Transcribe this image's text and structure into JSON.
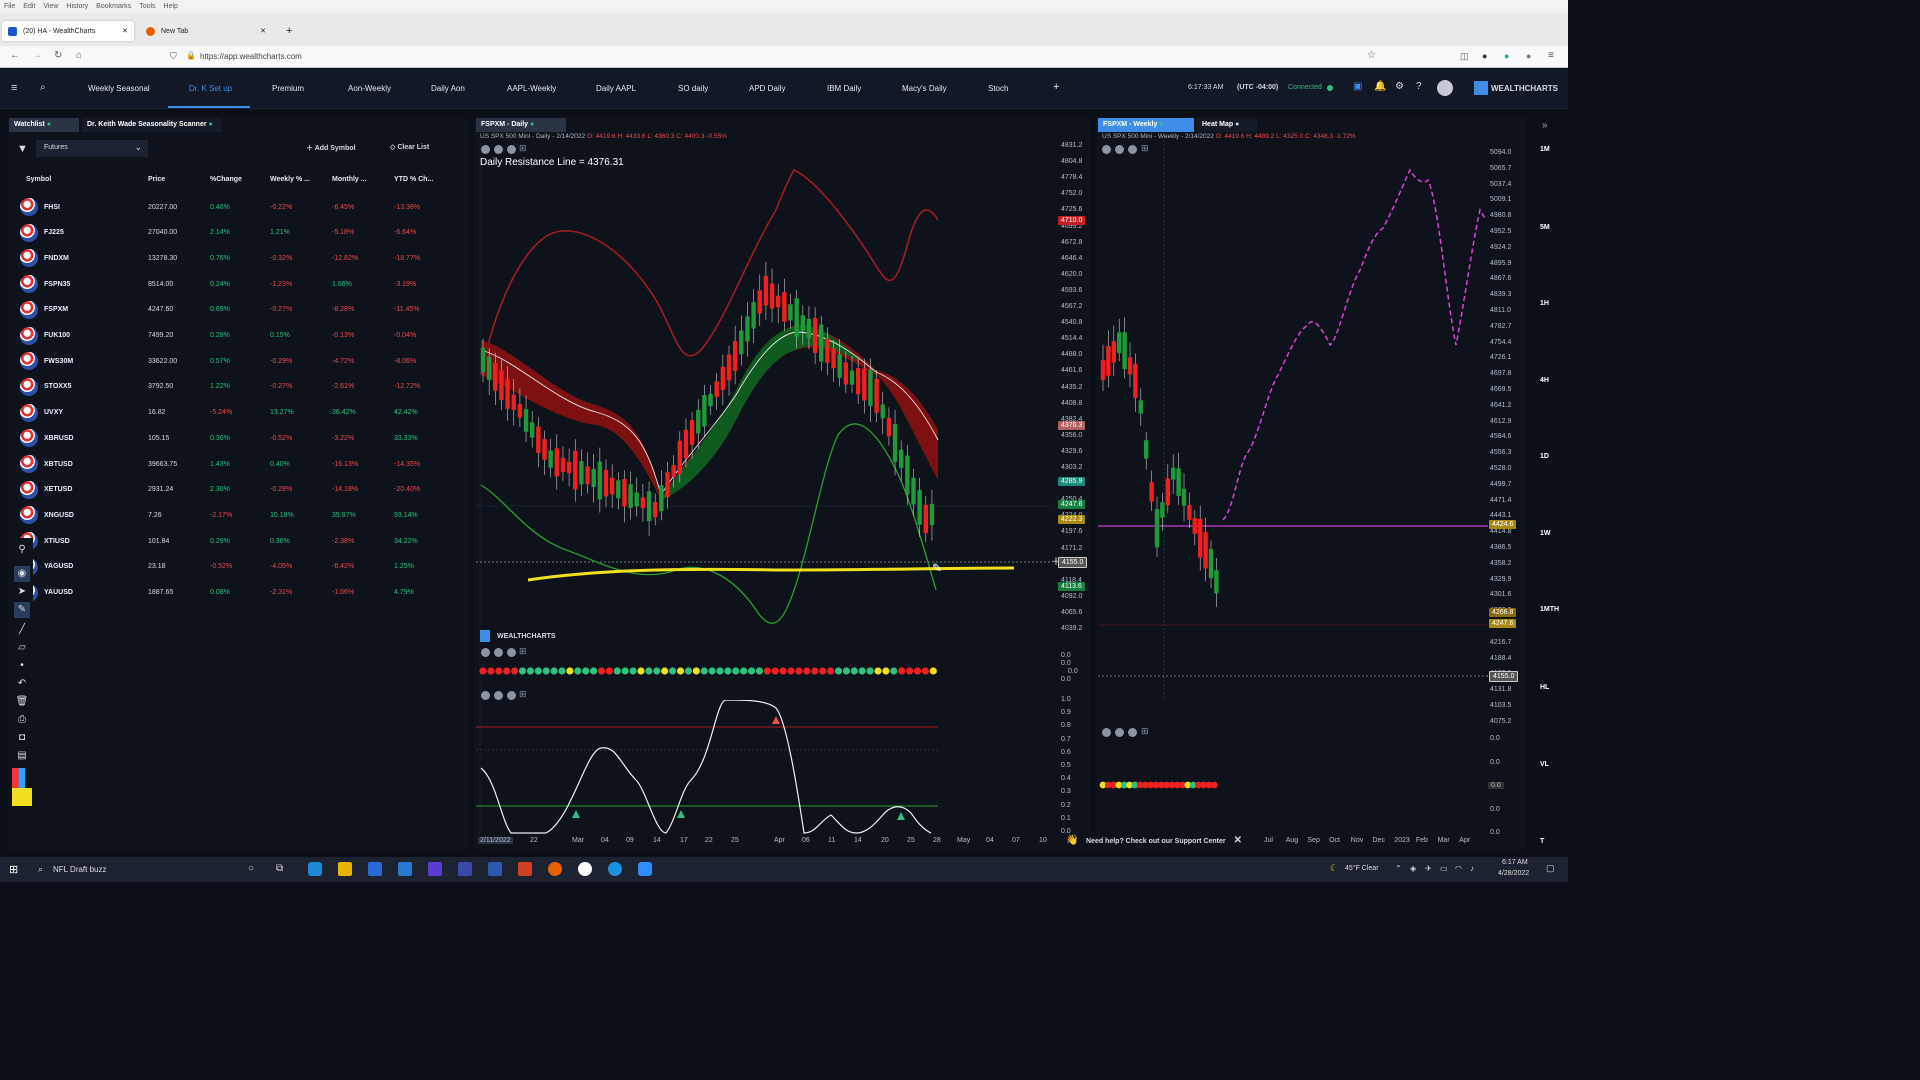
{
  "browser": {
    "menu": [
      "File",
      "Edit",
      "View",
      "History",
      "Bookmarks",
      "Tools",
      "Help"
    ],
    "tabs": [
      {
        "label": "(20) HA - WealthCharts"
      },
      {
        "label": "New Tab"
      }
    ],
    "url": "https://app.wealthcharts.com"
  },
  "nav": {
    "tabs": [
      "Weekly Seasonal",
      "Dr. K Set up",
      "Premium",
      "Aon-Weekly",
      "Daily Aon",
      "AAPL-Weekly",
      "Daily AAPL",
      "SO daily",
      "APD Daily",
      "IBM Daily",
      "Macy's Daily",
      "Stoch"
    ],
    "add": "+",
    "time": "6:17:33 AM",
    "tz": "(UTC -04:00)",
    "status": "Connected",
    "brand": "WEALTHCHARTS"
  },
  "watchlist": {
    "tab1": "Watchlist",
    "tab2": "Dr. Keith Wade Seasonality Scanner",
    "filter": "Futures",
    "add_symbol": "Add Symbol",
    "clear_list": "Clear List",
    "columns": [
      "Symbol",
      "Price",
      "%Change",
      "Weekly % ...",
      "Monthly ...",
      "YTD % Ch..."
    ],
    "rows": [
      [
        "FHSI",
        "20227.00",
        "0.46%",
        "-0.22%",
        "-6.45%",
        "-13.38%"
      ],
      [
        "FJ225",
        "27040.00",
        "2.14%",
        "1.21%",
        "-5.18%",
        "-6.64%"
      ],
      [
        "FNDXM",
        "13278.30",
        "0.76%",
        "-0.32%",
        "-12.82%",
        "-18.77%"
      ],
      [
        "FSPN35",
        "8514.00",
        "0.24%",
        "-1.23%",
        "1.66%",
        "-3.19%"
      ],
      [
        "FSPXM",
        "4247.60",
        "0.69%",
        "-0.27%",
        "-8.28%",
        "-11.45%"
      ],
      [
        "FUK100",
        "7499.20",
        "0.28%",
        "0.15%",
        "-0.13%",
        "-0.04%"
      ],
      [
        "FWS30M",
        "33622.00",
        "0.57%",
        "-0.29%",
        "-4.72%",
        "-8.06%"
      ],
      [
        "STOXX5",
        "3792.50",
        "1.22%",
        "-0.27%",
        "-2.61%",
        "-12.72%"
      ],
      [
        "UVXY",
        "16.82",
        "-5.24%",
        "13.27%",
        "36.42%",
        "42.42%"
      ],
      [
        "XBRUSD",
        "105.15",
        "0.36%",
        "-0.52%",
        "-3.22%",
        "33.33%"
      ],
      [
        "XBTUSD",
        "39663.75",
        "1.43%",
        "0.40%",
        "-16.13%",
        "-14.35%"
      ],
      [
        "XETUSD",
        "2931.24",
        "2.30%",
        "-0.28%",
        "-14.18%",
        "-20.40%"
      ],
      [
        "XNGUSD",
        "7.26",
        "-2.17%",
        "10.18%",
        "35.87%",
        "93.14%"
      ],
      [
        "XTIUSD",
        "101.84",
        "0.29%",
        "0.36%",
        "-2.38%",
        "34.22%"
      ],
      [
        "YAGUSD",
        "23.18",
        "-0.52%",
        "-4.05%",
        "-6.42%",
        "1.25%"
      ],
      [
        "YAUUSD",
        "1887.65",
        "0.08%",
        "-2.31%",
        "-1.66%",
        "4.79%"
      ]
    ]
  },
  "chart_main": {
    "tab": "FSPXM - Daily",
    "info_prefix": "US SPX 500 Mini - Daily - 2/14/2022",
    "o": "O: 4419.6",
    "h": "H: 4433.6",
    "l": "L: 4360.3",
    "c": "C: 4400.3",
    "chg": "-0.55%",
    "annotation": "Daily Resistance Line = 4376.31",
    "yticks": [
      "4831.2",
      "4804.8",
      "4778.4",
      "4752.0",
      "4725.6",
      "4699.2",
      "4672.8",
      "4646.4",
      "4620.0",
      "4593.6",
      "4567.2",
      "4540.8",
      "4514.4",
      "4488.0",
      "4461.6",
      "4435.2",
      "4408.8",
      "4382.4",
      "4356.0",
      "4329.6",
      "4303.2",
      "4276.8",
      "4250.4",
      "4224.0",
      "4197.6",
      "4171.2",
      "4144.8",
      "4118.4",
      "4092.0",
      "4065.6",
      "4039.2"
    ],
    "tags": [
      "4710.0",
      "4376.3",
      "4285.9",
      "4247.6",
      "4222.3",
      "4155.0",
      "4113.6"
    ],
    "xticks": [
      "2/11/2022",
      "22",
      "Mar",
      "04",
      "09",
      "14",
      "17",
      "22",
      "25",
      "Apr",
      "06",
      "11",
      "14",
      "20",
      "25",
      "28",
      "May",
      "04",
      "07",
      "10"
    ],
    "brand": "WEALTHCHARTS",
    "osc_ticks1": [
      "0.0",
      "0.0",
      "0.0",
      "0.0"
    ],
    "osc_ticks2": [
      "1.0",
      "0.9",
      "0.8",
      "0.7",
      "0.6",
      "0.5",
      "0.4",
      "0.3",
      "0.2",
      "0.1",
      "0.0"
    ]
  },
  "chart_weekly": {
    "tab": "FSPXM - Weekly",
    "tab2": "Heat Map",
    "info_prefix": "US SPX 500 Mini - Weekly - 2/14/2022",
    "o": "O: 4419.6",
    "h": "H: 4489.2",
    "l": "L: 4325.0",
    "c": "C: 4348.3",
    "chg": "-1.72%",
    "yticks": [
      "5094.0",
      "5065.7",
      "5037.4",
      "5009.1",
      "4980.8",
      "4952.5",
      "4924.2",
      "4895.9",
      "4867.6",
      "4839.3",
      "4811.0",
      "4782.7",
      "4754.4",
      "4726.1",
      "4697.8",
      "4669.5",
      "4641.2",
      "4612.9",
      "4584.6",
      "4556.3",
      "4528.0",
      "4499.7",
      "4471.4",
      "4443.1",
      "4414.8",
      "4386.5",
      "4358.2",
      "4329.9",
      "4301.6",
      "4273.3",
      "4245.0",
      "4216.7",
      "4188.4",
      "4160.1",
      "4131.8",
      "4103.5",
      "4075.2"
    ],
    "tags": [
      "4424.6",
      "4266.8",
      "4247.6",
      "4155.0"
    ],
    "lower_ticks": [
      "0.0",
      "0.0",
      "0.0",
      "0.0",
      "0.0"
    ],
    "xticks": [
      "Jul",
      "Aug",
      "Sep",
      "Oct",
      "Nov",
      "Dec",
      "2023",
      "Feb",
      "Mar",
      "Apr"
    ],
    "timeframes": [
      "1M",
      "5M",
      "1H",
      "4H",
      "1D",
      "1W",
      "1MTH",
      "HL",
      "VL",
      "T"
    ]
  },
  "support": {
    "text": "Need help? Check out our Support Center"
  },
  "taskbar": {
    "search": "NFL Draft buzz",
    "weather": "45°F  Clear",
    "time": "6:17 AM",
    "date": "4/28/2022"
  },
  "colors": {
    "up": "#2ec27e",
    "down": "#f24b4b",
    "accent": "#3e8ee8",
    "yellow": "#f0e020",
    "magenta": "#e040e0"
  }
}
